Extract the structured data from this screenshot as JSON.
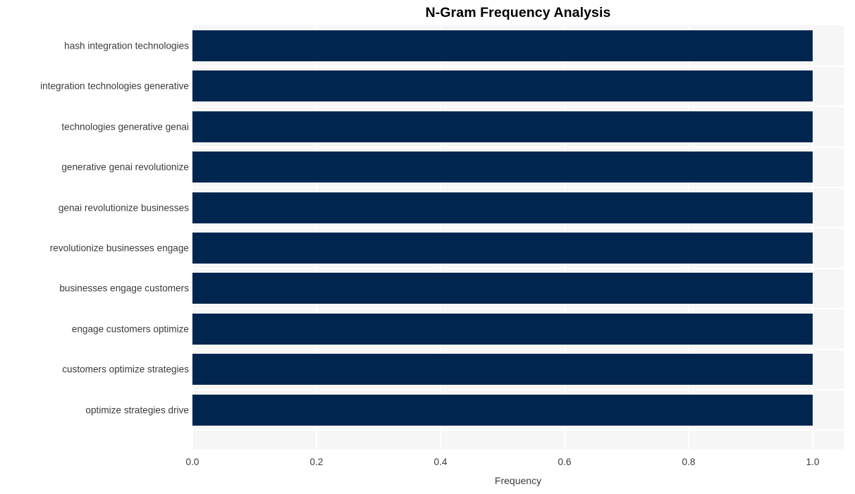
{
  "chart_data": {
    "type": "bar",
    "orientation": "horizontal",
    "title": "N-Gram Frequency Analysis",
    "xlabel": "Frequency",
    "ylabel": "",
    "xlim": [
      0.0,
      1.05
    ],
    "xticks": [
      "0.0",
      "0.2",
      "0.4",
      "0.6",
      "0.8",
      "1.0"
    ],
    "xtick_values": [
      0.0,
      0.2,
      0.4,
      0.6,
      0.8,
      1.0
    ],
    "grid": true,
    "legend": null,
    "categories": [
      "hash integration technologies",
      "integration technologies generative",
      "technologies generative genai",
      "generative genai revolutionize",
      "genai revolutionize businesses",
      "revolutionize businesses engage",
      "businesses engage customers",
      "engage customers optimize",
      "customers optimize strategies",
      "optimize strategies drive"
    ],
    "values": [
      1.0,
      1.0,
      1.0,
      1.0,
      1.0,
      1.0,
      1.0,
      1.0,
      1.0,
      1.0
    ],
    "bar_color": "#00264f",
    "plot_background": "#f6f6f7",
    "grid_color": "#ffffff",
    "figure_background": "#ffffff",
    "text_color": "#3b3b3b",
    "title_color": "#000000"
  }
}
